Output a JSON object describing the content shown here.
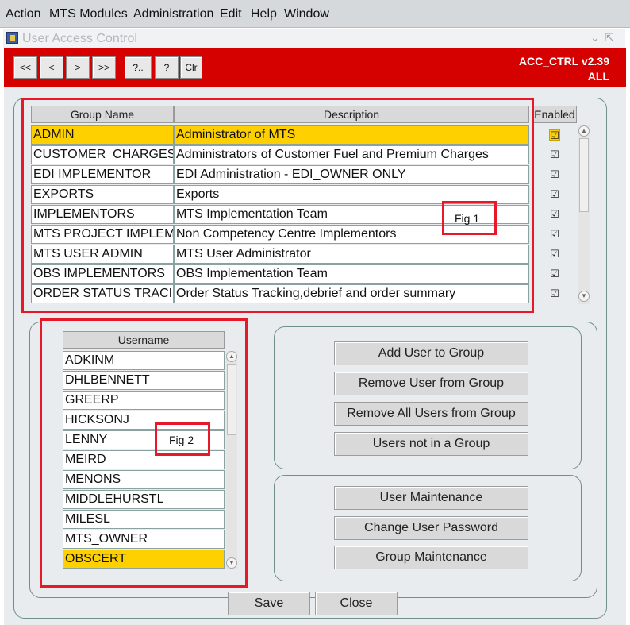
{
  "menu": [
    "Action",
    "MTS Modules",
    "Administration",
    "Edit",
    "Help",
    "Window"
  ],
  "window": {
    "title": "User Access Control"
  },
  "toolbar": {
    "buttons": [
      "<<",
      "<",
      ">",
      ">>",
      "?..",
      "?",
      "Clr"
    ],
    "version": "ACC_CTRL v2.39",
    "scope": "ALL"
  },
  "groups": {
    "columns": [
      "Group Name",
      "Description",
      "Enabled"
    ],
    "rows": [
      {
        "name": "ADMIN",
        "description": "Administrator of MTS",
        "enabled": "☑",
        "selected": true
      },
      {
        "name": "CUSTOMER_CHARGES",
        "description": "Administrators of Customer Fuel and Premium Charges",
        "enabled": "☑"
      },
      {
        "name": "EDI IMPLEMENTOR",
        "description": "EDI Administration - EDI_OWNER ONLY",
        "enabled": "☑"
      },
      {
        "name": "EXPORTS",
        "description": "Exports",
        "enabled": "☑"
      },
      {
        "name": "IMPLEMENTORS",
        "description": "MTS Implementation Team",
        "enabled": "☑"
      },
      {
        "name": "MTS PROJECT IMPLEM",
        "description": "Non Competency Centre Implementors",
        "enabled": "☑"
      },
      {
        "name": "MTS USER ADMIN",
        "description": "MTS User Administrator",
        "enabled": "☑"
      },
      {
        "name": "OBS IMPLEMENTORS",
        "description": "OBS Implementation Team",
        "enabled": "☑"
      },
      {
        "name": "ORDER STATUS TRACI",
        "description": "Order Status Tracking,debrief and order summary",
        "enabled": "☑"
      }
    ]
  },
  "users": {
    "column": "Username",
    "rows": [
      "ADKINM",
      "DHLBENNETT",
      "GREERP",
      "HICKSONJ",
      "LENNY",
      "MEIRD",
      "MENONS",
      "MIDDLEHURSTL",
      "MILESL",
      "MTS_OWNER",
      "OBSCERT"
    ],
    "selected_index": 10
  },
  "actions": {
    "group_buttons": [
      "Add User to Group",
      "Remove User from Group",
      "Remove All Users from Group",
      "Users not in a Group"
    ],
    "maint_buttons": [
      "User Maintenance",
      "Change User Password",
      "Group Maintenance"
    ]
  },
  "footer": {
    "save": "Save",
    "close": "Close"
  },
  "annotations": {
    "fig1": "Fig 1",
    "fig2": "Fig 2"
  },
  "icons": {
    "scroll_up": "▲",
    "scroll_down": "▼",
    "minimize": "⌄",
    "restore": "⇱"
  },
  "colors": {
    "accent_red": "#d50000",
    "selection": "#ffd000",
    "annotation_red": "#e6182a"
  }
}
